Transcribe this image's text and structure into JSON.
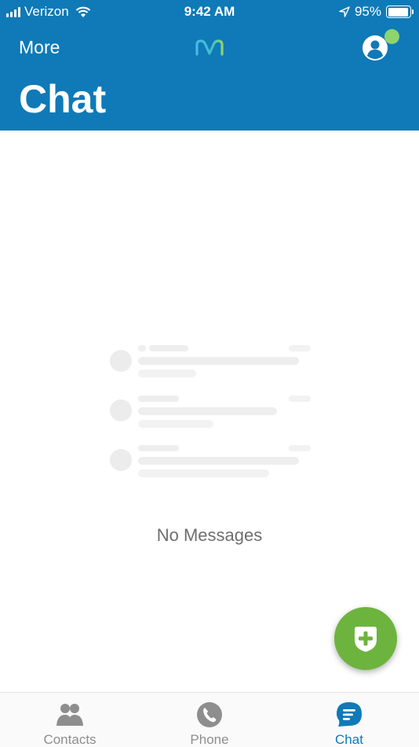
{
  "status_bar": {
    "carrier": "Verizon",
    "time": "9:42 AM",
    "battery_percent": "95%",
    "battery_level": 0.95,
    "icons": [
      "signal-bars-icon",
      "wifi-icon",
      "location-arrow-icon",
      "battery-icon"
    ]
  },
  "header": {
    "more_label": "More",
    "title": "Chat",
    "logo_icon": "brand-m-logo",
    "profile_icon": "user-profile-icon",
    "presence_status_color": "#8ed46f",
    "background_color": "#0f7ab7"
  },
  "main": {
    "empty_message": "No Messages",
    "placeholder_icon": "chat-list-placeholder-illustration"
  },
  "fab": {
    "icon": "new-chat-plus-icon",
    "color": "#6db43e"
  },
  "tabs": [
    {
      "label": "Contacts",
      "icon": "contacts-icon",
      "active": false
    },
    {
      "label": "Phone",
      "icon": "phone-icon",
      "active": false
    },
    {
      "label": "Chat",
      "icon": "chat-icon",
      "active": true
    }
  ],
  "colors": {
    "accent": "#0f7ab7",
    "inactive_tab": "#8e8e8e",
    "placeholder": "#ececec"
  }
}
